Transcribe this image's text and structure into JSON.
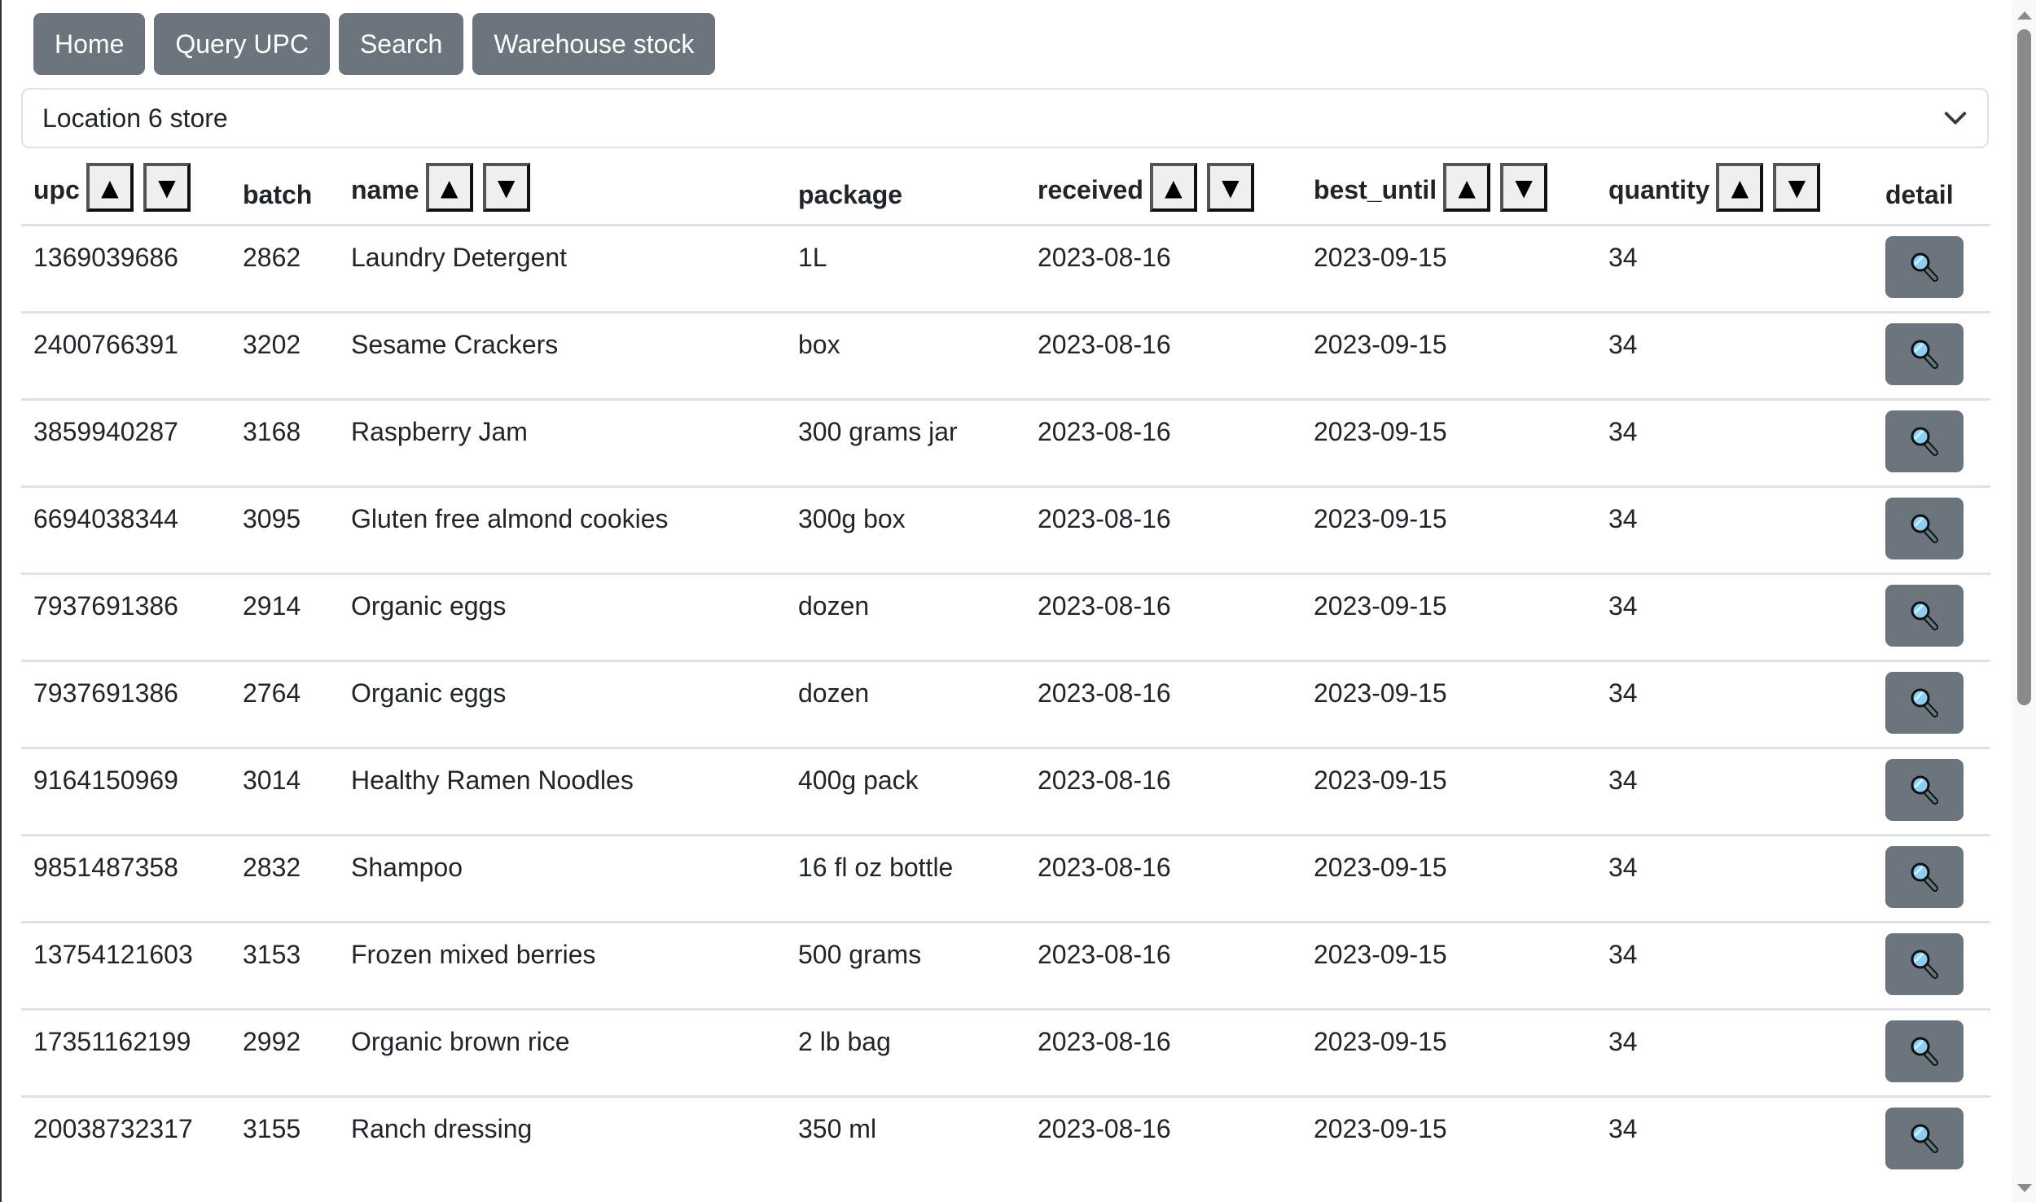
{
  "nav": {
    "buttons": [
      {
        "label": "Home"
      },
      {
        "label": "Query UPC"
      },
      {
        "label": "Search"
      },
      {
        "label": "Warehouse stock"
      }
    ]
  },
  "location_select": {
    "selected": "Location 6 store",
    "icon": "chevron-down-icon"
  },
  "table": {
    "columns": [
      {
        "key": "upc",
        "label": "upc",
        "sortable": true
      },
      {
        "key": "batch",
        "label": "batch",
        "sortable": false
      },
      {
        "key": "name",
        "label": "name",
        "sortable": true
      },
      {
        "key": "package",
        "label": "package",
        "sortable": false
      },
      {
        "key": "received",
        "label": "received",
        "sortable": true
      },
      {
        "key": "best_until",
        "label": "best_until",
        "sortable": true
      },
      {
        "key": "quantity",
        "label": "quantity",
        "sortable": true
      },
      {
        "key": "detail",
        "label": "detail",
        "sortable": false
      }
    ],
    "sort_up_glyph": "▲",
    "sort_down_glyph": "▼",
    "detail_icon": "magnifying-glass-icon",
    "rows": [
      {
        "upc": "1369039686",
        "batch": "2862",
        "name": "Laundry Detergent",
        "package": "1L",
        "received": "2023-08-16",
        "best_until": "2023-09-15",
        "quantity": "34"
      },
      {
        "upc": "2400766391",
        "batch": "3202",
        "name": "Sesame Crackers",
        "package": "box",
        "received": "2023-08-16",
        "best_until": "2023-09-15",
        "quantity": "34"
      },
      {
        "upc": "3859940287",
        "batch": "3168",
        "name": "Raspberry Jam",
        "package": "300 grams jar",
        "received": "2023-08-16",
        "best_until": "2023-09-15",
        "quantity": "34"
      },
      {
        "upc": "6694038344",
        "batch": "3095",
        "name": "Gluten free almond cookies",
        "package": "300g box",
        "received": "2023-08-16",
        "best_until": "2023-09-15",
        "quantity": "34"
      },
      {
        "upc": "7937691386",
        "batch": "2914",
        "name": "Organic eggs",
        "package": "dozen",
        "received": "2023-08-16",
        "best_until": "2023-09-15",
        "quantity": "34"
      },
      {
        "upc": "7937691386",
        "batch": "2764",
        "name": "Organic eggs",
        "package": "dozen",
        "received": "2023-08-16",
        "best_until": "2023-09-15",
        "quantity": "34"
      },
      {
        "upc": "9164150969",
        "batch": "3014",
        "name": "Healthy Ramen Noodles",
        "package": "400g pack",
        "received": "2023-08-16",
        "best_until": "2023-09-15",
        "quantity": "34"
      },
      {
        "upc": "9851487358",
        "batch": "2832",
        "name": "Shampoo",
        "package": "16 fl oz bottle",
        "received": "2023-08-16",
        "best_until": "2023-09-15",
        "quantity": "34"
      },
      {
        "upc": "13754121603",
        "batch": "3153",
        "name": "Frozen mixed berries",
        "package": "500 grams",
        "received": "2023-08-16",
        "best_until": "2023-09-15",
        "quantity": "34"
      },
      {
        "upc": "17351162199",
        "batch": "2992",
        "name": "Organic brown rice",
        "package": "2 lb bag",
        "received": "2023-08-16",
        "best_until": "2023-09-15",
        "quantity": "34"
      },
      {
        "upc": "20038732317",
        "batch": "3155",
        "name": "Ranch dressing",
        "package": "350 ml",
        "received": "2023-08-16",
        "best_until": "2023-09-15",
        "quantity": "34"
      }
    ]
  },
  "colors": {
    "button_bg": "#6c757d",
    "button_text": "#ffffff",
    "border": "#dee2e6",
    "text": "#212529"
  }
}
